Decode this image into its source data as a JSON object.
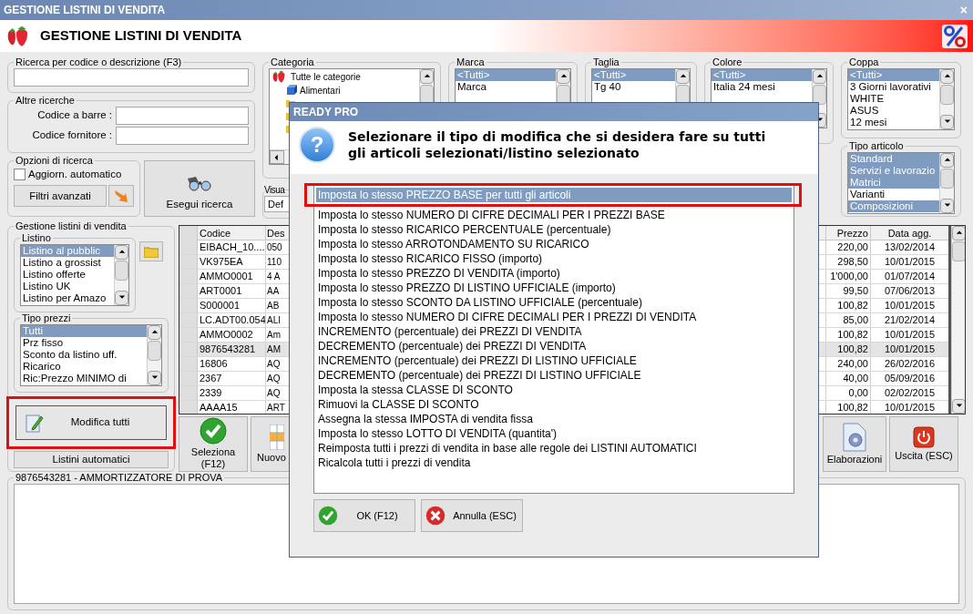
{
  "window": {
    "title": "GESTIONE LISTINI DI VENDITA",
    "close": "×"
  },
  "header": {
    "title": "GESTIONE LISTINI DI VENDITA"
  },
  "search": {
    "legend": "Ricerca per codice o descrizione (F3)"
  },
  "other_searches": {
    "legend": "Altre ricerche",
    "fields": [
      {
        "label": "Codice a barre :"
      },
      {
        "label": "Codice fornitore :"
      }
    ]
  },
  "search_options": {
    "legend": "Opzioni di ricerca",
    "auto_update": {
      "label": "Aggiorn. automatico",
      "checked": false
    },
    "advanced_filters": "Filtri avanzati"
  },
  "run_search": "Esegui ricerca",
  "category": {
    "legend": "Categoria",
    "tree": [
      {
        "label": "Tutte le categorie",
        "children": [
          {
            "label": "Alimentari"
          }
        ]
      }
    ]
  },
  "view": {
    "legend": "Visua",
    "value": "Def"
  },
  "filters": [
    {
      "legend": "Marca",
      "items": [
        {
          "label": "<Tutti>",
          "selected": true
        },
        {
          "label": "Marca",
          "selected": false
        }
      ]
    },
    {
      "legend": "Taglia",
      "items": [
        {
          "label": "<Tutti>",
          "selected": true
        },
        {
          "label": "Tg 40",
          "selected": false
        }
      ]
    },
    {
      "legend": "Colore",
      "items": [
        {
          "label": "<Tutti>",
          "selected": true
        },
        {
          "label": "Italia 24 mesi",
          "selected": false
        }
      ]
    },
    {
      "legend": "Coppa",
      "items": [
        {
          "label": "<Tutti>",
          "selected": true
        },
        {
          "label": "3 Giorni lavorativi",
          "selected": false
        },
        {
          "label": "WHITE",
          "selected": false
        },
        {
          "label": "ASUS",
          "selected": false
        },
        {
          "label": "12 mesi",
          "selected": false
        }
      ]
    }
  ],
  "article_type": {
    "legend": "Tipo articolo",
    "items": [
      {
        "label": "Standard",
        "selected": true
      },
      {
        "label": "Servizi e lavorazio",
        "selected": true
      },
      {
        "label": "Matrici",
        "selected": true
      },
      {
        "label": "Varianti",
        "selected": false
      },
      {
        "label": "Composizioni",
        "selected": true
      }
    ]
  },
  "price_lists": {
    "legend": "Gestione listini di vendita",
    "listino": {
      "legend": "Listino",
      "items": [
        {
          "label": "Listino al pubblic",
          "selected": true
        },
        {
          "label": "Listino a grossist",
          "selected": false
        },
        {
          "label": "Listino offerte",
          "selected": false
        },
        {
          "label": "Listino UK",
          "selected": false
        },
        {
          "label": "Listino per Amazo",
          "selected": false
        }
      ]
    },
    "price_types": {
      "legend": "Tipo prezzi",
      "items": [
        {
          "label": "Tutti",
          "selected": true
        },
        {
          "label": "Prz fisso",
          "selected": false
        },
        {
          "label": "Sconto da listino uff.",
          "selected": false
        },
        {
          "label": "Ricarico",
          "selected": false
        },
        {
          "label": "Ric:Prezzo MINIMO di",
          "selected": false
        }
      ]
    },
    "edit_all": {
      "label": "Modifica tutti",
      "highlighted": true
    },
    "auto_lists": "Listini automatici"
  },
  "grid": {
    "columns": [
      "Codice",
      "Des",
      "Prezzo",
      "Data agg."
    ],
    "rows": [
      {
        "code": "EIBACH_10....",
        "desc": "050",
        "price": "220,00",
        "date": "13/02/2014",
        "selected": false
      },
      {
        "code": "VK975EA",
        "desc": "110",
        "price": "298,50",
        "date": "10/01/2015",
        "selected": false
      },
      {
        "code": "AMMO0001",
        "desc": "4 A",
        "price": "1'000,00",
        "date": "01/07/2014",
        "selected": false
      },
      {
        "code": "ART0001",
        "desc": "AA",
        "price": "99,50",
        "date": "07/06/2013",
        "selected": false
      },
      {
        "code": "S000001",
        "desc": "AB",
        "price": "100,82",
        "date": "10/01/2015",
        "selected": false
      },
      {
        "code": "LC.ADT00.054",
        "desc": "ALI",
        "price": "85,00",
        "date": "21/02/2014",
        "selected": false
      },
      {
        "code": "AMMO0002",
        "desc": "Am",
        "price": "100,82",
        "date": "10/01/2015",
        "selected": false
      },
      {
        "code": "9876543281",
        "desc": "AM",
        "price": "100,82",
        "date": "10/01/2015",
        "selected": true
      },
      {
        "code": "16806",
        "desc": "AQ",
        "price": "240,00",
        "date": "26/02/2016",
        "selected": false
      },
      {
        "code": "2367",
        "desc": "AQ",
        "price": "40,00",
        "date": "05/09/2016",
        "selected": false
      },
      {
        "code": "2339",
        "desc": "AQ",
        "price": "0,00",
        "date": "02/02/2015",
        "selected": false
      },
      {
        "code": "AAAA15",
        "desc": "ART",
        "price": "100,82",
        "date": "10/01/2015",
        "selected": false
      }
    ]
  },
  "toolbar": [
    {
      "label": "Seleziona (F12)",
      "kind": "check"
    },
    {
      "label": "Nuovo",
      "kind": "grid"
    },
    {
      "label": "Elaborazioni",
      "kind": "gear"
    },
    {
      "label": "Uscita (ESC)",
      "kind": "power"
    }
  ],
  "detail": {
    "legend": "9876543281 - AMMORTIZZATORE DI PROVA"
  },
  "dialog": {
    "title": "READY PRO",
    "icon": "?",
    "message": "Selezionare il tipo di modifica che si desidera fare su tutti gli articoli selezionati/listino selezionato",
    "options": [
      {
        "label": "Imposta lo stesso PREZZO BASE per tutti gli articoli",
        "selected": true,
        "highlighted": true
      },
      {
        "label": "Imposta lo stesso NUMERO DI CIFRE DECIMALI PER I PREZZI BASE",
        "selected": false,
        "highlighted": false
      },
      {
        "label": "Imposta lo stesso RICARICO PERCENTUALE (percentuale)",
        "selected": false,
        "highlighted": false
      },
      {
        "label": "Imposta lo stesso ARROTONDAMENTO SU RICARICO",
        "selected": false,
        "highlighted": false
      },
      {
        "label": "Imposta lo stesso RICARICO FISSO (importo)",
        "selected": false,
        "highlighted": false
      },
      {
        "label": "Imposta lo stesso PREZZO DI VENDITA (importo)",
        "selected": false,
        "highlighted": false
      },
      {
        "label": "Imposta lo stesso PREZZO DI LISTINO UFFICIALE (importo)",
        "selected": false,
        "highlighted": false
      },
      {
        "label": "Imposta lo stesso SCONTO DA LISTINO UFFICIALE (percentuale)",
        "selected": false,
        "highlighted": false
      },
      {
        "label": "Imposta lo stesso NUMERO DI CIFRE DECIMALI PER I PREZZI DI VENDITA",
        "selected": false,
        "highlighted": false
      },
      {
        "label": "INCREMENTO (percentuale) dei PREZZI DI VENDITA",
        "selected": false,
        "highlighted": false
      },
      {
        "label": "DECREMENTO (percentuale) dei PREZZI DI VENDITA",
        "selected": false,
        "highlighted": false
      },
      {
        "label": "INCREMENTO (percentuale) dei PREZZI DI LISTINO UFFICIALE",
        "selected": false,
        "highlighted": false
      },
      {
        "label": "DECREMENTO (percentuale) dei PREZZI DI LISTINO UFFICIALE",
        "selected": false,
        "highlighted": false
      },
      {
        "label": "Imposta la stessa CLASSE DI SCONTO",
        "selected": false,
        "highlighted": false
      },
      {
        "label": "Rimuovi la CLASSE DI SCONTO",
        "selected": false,
        "highlighted": false
      },
      {
        "label": "Assegna la stessa IMPOSTA di vendita fissa",
        "selected": false,
        "highlighted": false
      },
      {
        "label": "Imposta lo stesso LOTTO DI VENDITA (quantita')",
        "selected": false,
        "highlighted": false
      },
      {
        "label": "Reimposta tutti i prezzi di vendita in base alle regole dei LISTINI AUTOMATICI",
        "selected": false,
        "highlighted": false
      },
      {
        "label": "Ricalcola tutti i prezzi di vendita",
        "selected": false,
        "highlighted": false
      }
    ],
    "buttons": [
      {
        "label": "OK (F12)",
        "kind": "ok"
      },
      {
        "label": "Annulla (ESC)",
        "kind": "cancel"
      }
    ]
  }
}
